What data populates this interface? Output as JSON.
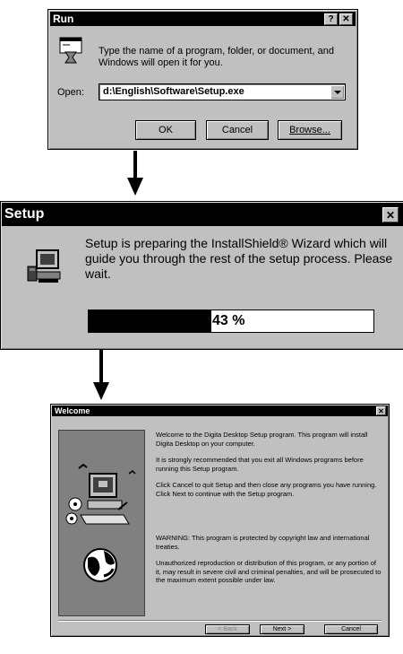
{
  "run": {
    "title": "Run",
    "help_label": "?",
    "close_label": "✕",
    "description": "Type the name of a program, folder, or document, and Windows will open it for you.",
    "open_label": "Open:",
    "open_value": "d:\\English\\Software\\Setup.exe",
    "ok_label": "OK",
    "cancel_label": "Cancel",
    "browse_label": "Browse..."
  },
  "setup": {
    "title": "Setup",
    "close_label": "✕",
    "message": "Setup is preparing the InstallShield® Wizard which will guide you through the rest of the setup process.  Please wait.",
    "progress_percent": 43,
    "progress_text": "43 %"
  },
  "welcome": {
    "title": "Welcome",
    "close_label": "✕",
    "paragraphs": [
      "Welcome to the Digita Desktop Setup program.  This program will install Digita Desktop on your computer.",
      "It is strongly recommended that you exit all Windows programs before running this Setup program.",
      "Click Cancel to quit Setup and then close any programs you have running.  Click Next to continue with the Setup program.",
      "WARNING: This program is protected by copyright law and international treaties.",
      "Unauthorized reproduction or distribution of this program, or any portion of it, may result in severe civil and criminal penalties, and will be prosecuted to the maximum extent possible under law."
    ],
    "back_label": "< Back",
    "next_label": "Next >",
    "cancel_label": "Cancel"
  }
}
